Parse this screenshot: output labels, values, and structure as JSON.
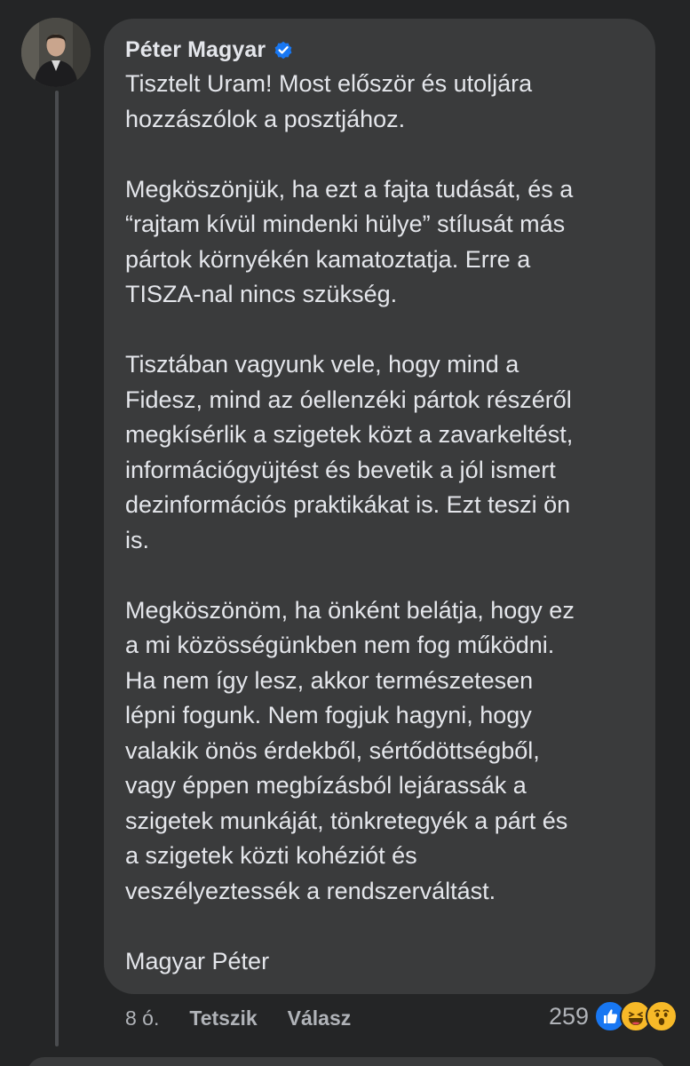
{
  "comment": {
    "author": "Péter Magyar",
    "verified": true,
    "paragraphs": [
      "Tisztelt Uram! Most először és utoljára\nhozzászólok a posztjához.",
      "Megköszönjük, ha ezt a fajta tudását, és a\n“rajtam kívül mindenki hülye” stílusát más\npártok környékén kamatoztatja. Erre a\nTISZA-nal nincs szükség.",
      "Tisztában vagyunk vele, hogy mind a\nFidesz, mind az óellenzéki pártok részéről\nmegkísérlik a szigetek közt a zavarkeltést,\ninformációgyüjtést és bevetik a jól ismert\ndezinformációs praktikákat is. Ezt teszi ön\nis.",
      "Megköszönöm, ha önként belátja, hogy ez\na mi közösségünkben nem fog működni.\nHa nem így lesz, akkor természetesen\nlépni fogunk. Nem fogjuk hagyni, hogy\nvalakik önös érdekből, sértődöttségből,\nvagy éppen megbízásból lejárassák a\nszigetek munkáját, tönkretegyék a párt és\na szigetek közti kohéziót és\nveszélyeztessék a rendszerváltást.",
      "Magyar Péter"
    ],
    "time": "8 ó.",
    "like_label": "Tetszik",
    "reply_label": "Válasz",
    "reaction_count": "259",
    "reactions": [
      "like-icon",
      "haha-icon",
      "wow-icon"
    ],
    "colors": {
      "background": "#242526",
      "bubble": "#3a3b3c",
      "text": "#e4e6eb",
      "secondary_text": "#b0b3b8",
      "verified": "#1877f2",
      "like": "#1877f2",
      "emoji": "#f7b928"
    }
  }
}
